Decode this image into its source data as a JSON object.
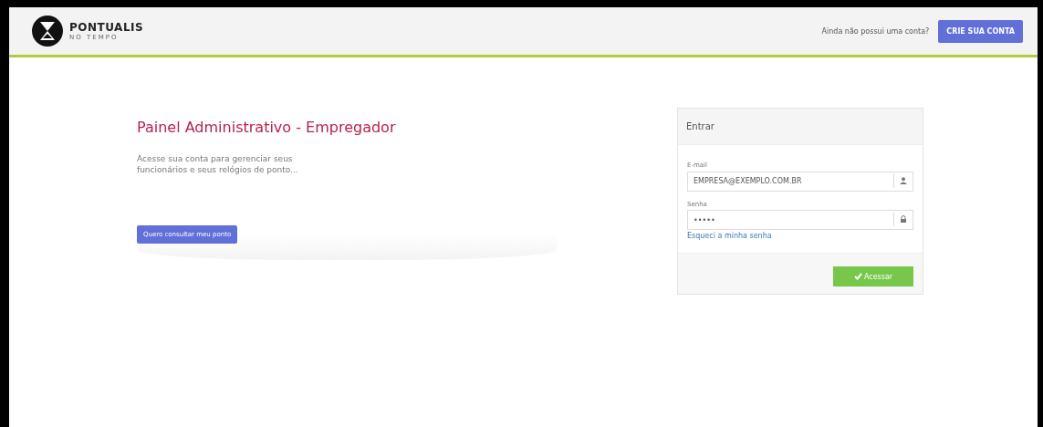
{
  "header": {
    "logo": {
      "name": "PONTUALIS",
      "tagline": "NO TEMPO"
    },
    "signup_prompt": "Ainda não possui uma conta?",
    "signup_button": "CRIE SUA CONTA"
  },
  "intro": {
    "title": "Painel Administrativo - Empregador",
    "text": "Acesse sua conta para gerenciar seus funcionários e seus relógios de ponto...",
    "button": "Quero consultar meu ponto"
  },
  "login": {
    "title": "Entrar",
    "fields": [
      {
        "label": "E-mail",
        "value": "EMPRESA@EXEMPLO.COM.BR",
        "kind": "user"
      },
      {
        "label": "Senha",
        "value": "•••••",
        "kind": "lock"
      }
    ],
    "forgot_link": "Esqueci a minha senha",
    "submit": "Acessar"
  }
}
